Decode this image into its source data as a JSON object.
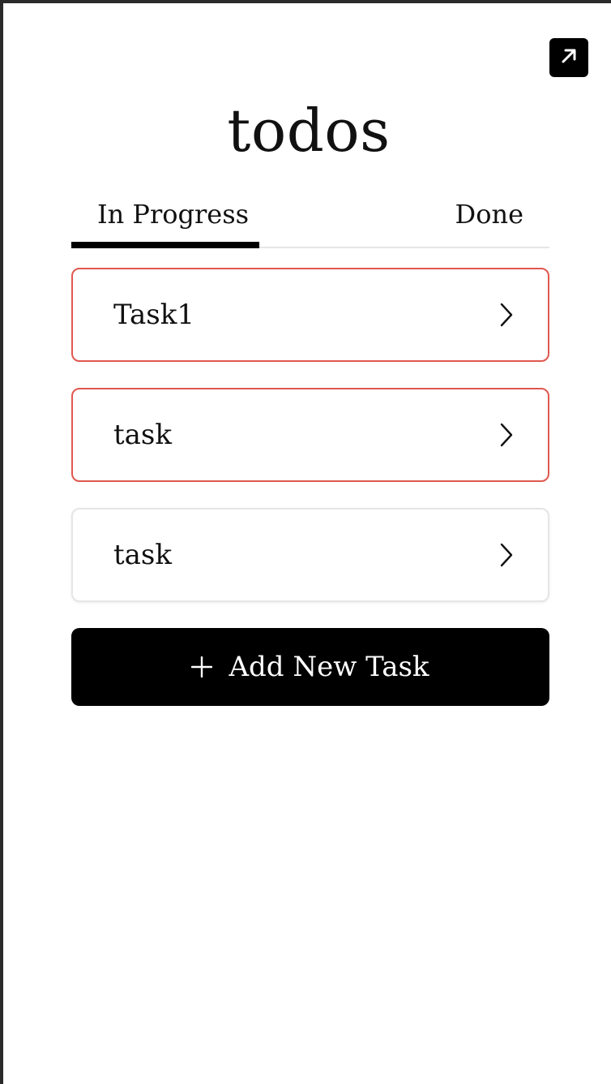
{
  "app": {
    "title": "todos"
  },
  "toolbar": {
    "expand_icon": "arrow-up-right-icon"
  },
  "tabs": [
    {
      "label": "In Progress",
      "active": true
    },
    {
      "label": "Done",
      "active": false
    }
  ],
  "tasks": [
    {
      "label": "Task1",
      "urgent": true
    },
    {
      "label": "task",
      "urgent": true
    },
    {
      "label": "task",
      "urgent": false
    }
  ],
  "add_button": {
    "label": "Add New Task",
    "icon": "plus-icon"
  },
  "colors": {
    "urgent_border": "#e0584f",
    "default_border": "#e6e6e6",
    "primary": "#000000"
  }
}
